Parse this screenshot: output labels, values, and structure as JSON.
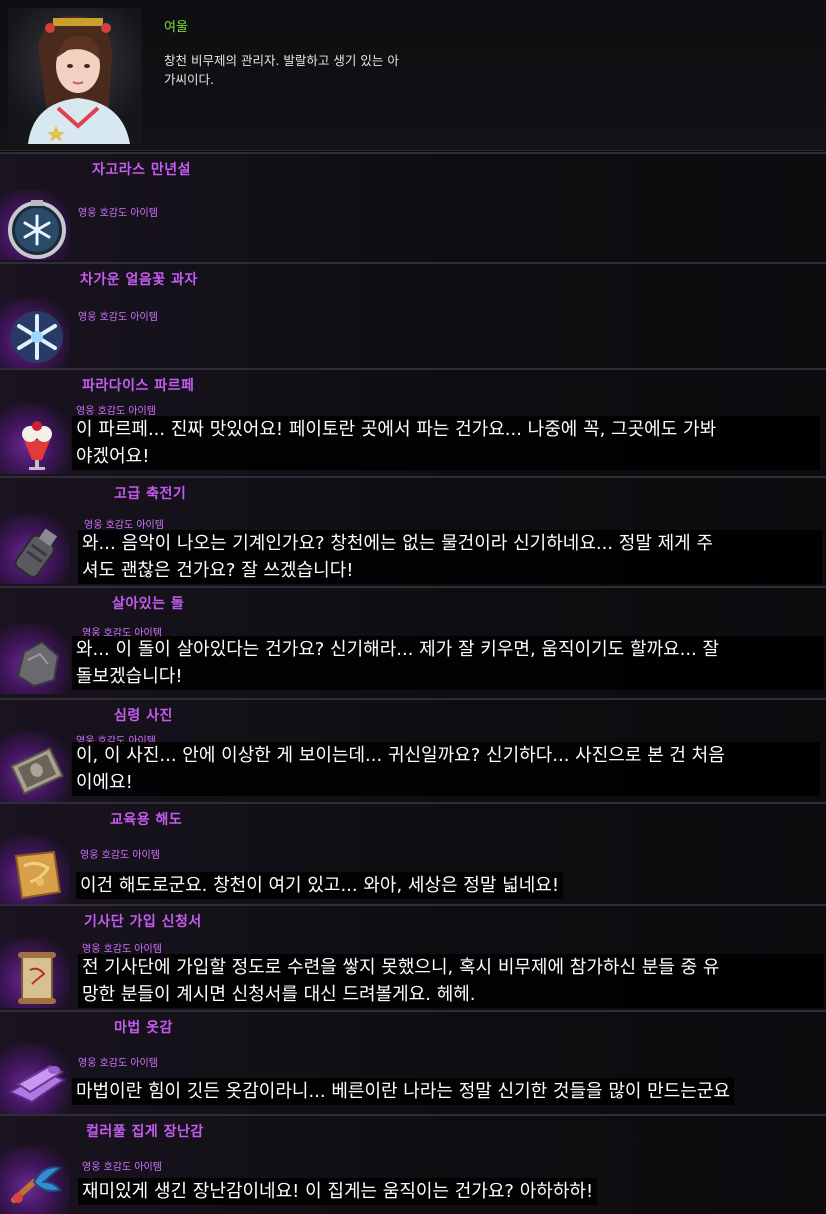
{
  "npc": {
    "name": "여울",
    "description": "창천 비무제의 관리자. 발랄하고 생기 있는 아\n가씨이다."
  },
  "colors": {
    "npc_name": "#7dde3a",
    "item_name": "#c45cf0",
    "tag": "#d070ff"
  },
  "items": [
    {
      "name": "자고라스 만년설",
      "tag": "영웅 호감도 아이템",
      "icon": "snow-orb-icon",
      "dialog": ""
    },
    {
      "name": "차가운 얼음꽃 과자",
      "tag": "영웅 호감도 아이템",
      "icon": "ice-flower-cookie-icon",
      "dialog": ""
    },
    {
      "name": "파라다이스 파르페",
      "tag": "영웅 호감도 아이템",
      "icon": "parfait-icon",
      "dialog": "이 파르페... 진짜 맛있어요! 페이토란 곳에서 파는 건가요... 나중에 꼭, 그곳에도 가봐\n야겠어요!"
    },
    {
      "name": "고급 축전기",
      "tag": "영웅 호감도 아이템",
      "icon": "capacitor-icon",
      "dialog": "와... 음악이 나오는 기계인가요? 창천에는 없는 물건이라 신기하네요... 정말 제게 주\n셔도 괜찮은 건가요? 잘 쓰겠습니다!"
    },
    {
      "name": "살아있는 돌",
      "tag": "영웅 호감도 아이템",
      "icon": "living-stone-icon",
      "dialog": "와... 이 돌이 살아있다는 건가요? 신기해라... 제가 잘 키우면, 움직이기도 할까요... 잘\n돌보겠습니다!"
    },
    {
      "name": "심령 사진",
      "tag": "영웅 호감도 아이템",
      "icon": "spirit-photo-icon",
      "dialog": "이, 이 사진... 안에 이상한 게 보이는데... 귀신일까요? 신기하다... 사진으로 본 건 처음\n이에요!"
    },
    {
      "name": "교육용 해도",
      "tag": "영웅 호감도 아이템",
      "icon": "sea-chart-icon",
      "dialog": "이건 해도로군요. 창천이 여기 있고... 와아, 세상은 정말 넓네요!"
    },
    {
      "name": "기사단 가입 신청서",
      "tag": "영웅 호감도 아이템",
      "icon": "application-scroll-icon",
      "dialog": "전 기사단에 가입할 정도로 수련을 쌓지 못했으니, 혹시 비무제에 참가하신 분들 중 유\n망한 분들이 계시면 신청서를 대신 드려볼게요. 헤헤."
    },
    {
      "name": "마법 옷감",
      "tag": "영웅 호감도 아이템",
      "icon": "magic-cloth-icon",
      "dialog": "마법이란 힘이 깃든 옷감이라니... 베른이란 나라는 정말 신기한 것들을 많이 만드는군요"
    },
    {
      "name": "컬러풀 집게 장난감",
      "tag": "영웅 호감도 아이템",
      "icon": "crab-claw-toy-icon",
      "dialog": "재미있게 생긴 장난감이네요! 이 집게는 움직이는 건가요? 아하하하!"
    }
  ]
}
